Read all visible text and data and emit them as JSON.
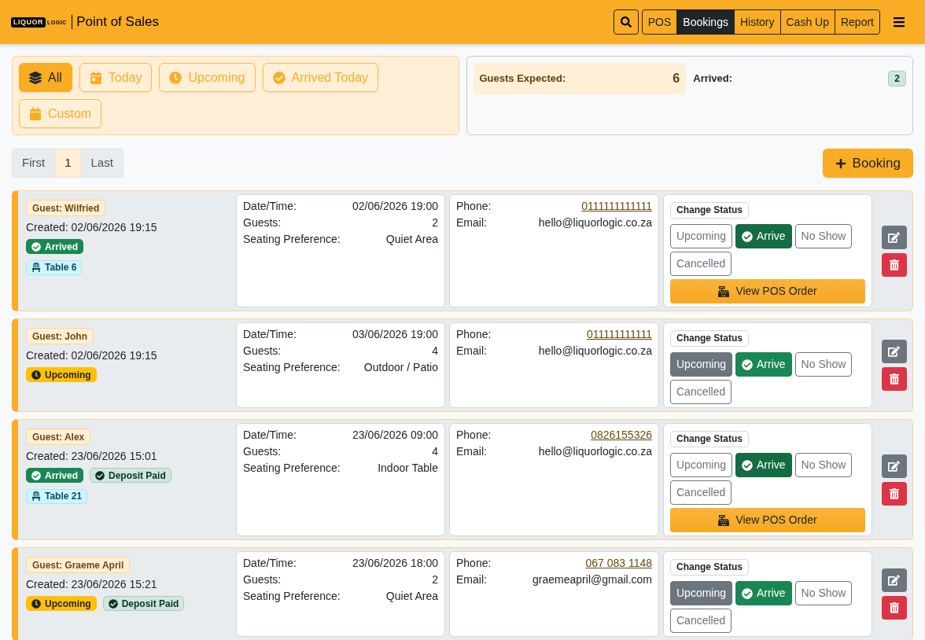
{
  "header": {
    "logo": {
      "part_1": "LIQUOR",
      "part_2": "LOGIC"
    },
    "title": "Point of Sales",
    "nav": [
      {
        "label": "POS",
        "selected": false
      },
      {
        "label": "Bookings",
        "selected": true
      },
      {
        "label": "History",
        "selected": false
      },
      {
        "label": "Cash Up",
        "selected": false
      },
      {
        "label": "Report",
        "selected": false
      }
    ]
  },
  "filters": [
    {
      "label": "All",
      "selected": true
    },
    {
      "label": "Today",
      "selected": false
    },
    {
      "label": "Upcoming",
      "selected": false
    },
    {
      "label": "Arrived Today",
      "selected": false
    },
    {
      "label": "Custom",
      "selected": false
    }
  ],
  "stats": {
    "guests_expected": {
      "label": "Guests Expected:",
      "value": "6"
    },
    "arrived": {
      "label": "Arrived:",
      "value": "2"
    }
  },
  "pagination": [
    {
      "label": "First",
      "selected": false
    },
    {
      "label": "1",
      "selected": true
    },
    {
      "label": "Last",
      "selected": false
    }
  ],
  "add_booking_button": "Booking",
  "bookings": [
    {
      "guest": "Guest: Wilfried",
      "created": "Created: 02/06/2026 19:15",
      "badges": [
        {
          "kind": "arrived",
          "label": "Arrived"
        }
      ],
      "table": "Table 6",
      "details": [
        {
          "label": "Date/Time:",
          "value": "02/06/2026 19:00"
        },
        {
          "label": "Guests:",
          "value": "2"
        },
        {
          "label": "Seating Preference:",
          "value": "Quiet Area"
        }
      ],
      "contact": [
        {
          "kind": "link",
          "label": "Phone:",
          "value": "0111111111111"
        },
        {
          "kind": "text",
          "label": "Email:",
          "value": "hello@liquorlogic.co.za"
        }
      ],
      "change_status": "Change Status",
      "status_buttons": [
        {
          "kind": "neutral",
          "label": "Upcoming",
          "selected": false
        },
        {
          "kind": "success",
          "label": "Arrive",
          "selected": true
        },
        {
          "kind": "neutral",
          "label": "No Show",
          "selected": false
        },
        {
          "kind": "neutral",
          "label": "Cancelled",
          "selected": false
        }
      ],
      "pos_order_button": "View POS Order"
    },
    {
      "guest": "Guest: John",
      "created": "Created: 02/06/2026 19:15",
      "badges": [
        {
          "kind": "upcoming",
          "label": "Upcoming"
        }
      ],
      "details": [
        {
          "label": "Date/Time:",
          "value": "03/06/2026 19:00"
        },
        {
          "label": "Guests:",
          "value": "4"
        },
        {
          "label": "Seating Preference:",
          "value": "Outdoor / Patio"
        }
      ],
      "contact": [
        {
          "kind": "link",
          "label": "Phone:",
          "value": "011111111111"
        },
        {
          "kind": "text",
          "label": "Email:",
          "value": "hello@liquorlogic.co.za"
        }
      ],
      "change_status": "Change Status",
      "status_buttons": [
        {
          "kind": "neutral",
          "label": "Upcoming",
          "selected": true
        },
        {
          "kind": "success",
          "label": "Arrive",
          "selected": false
        },
        {
          "kind": "neutral",
          "label": "No Show",
          "selected": false
        },
        {
          "kind": "neutral",
          "label": "Cancelled",
          "selected": false
        }
      ]
    },
    {
      "guest": "Guest: Alex",
      "created": "Created: 23/06/2026 15:01",
      "badges": [
        {
          "kind": "arrived",
          "label": "Arrived"
        },
        {
          "kind": "deposit",
          "label": "Deposit Paid"
        }
      ],
      "table": "Table 21",
      "details": [
        {
          "label": "Date/Time:",
          "value": "23/06/2026 09:00"
        },
        {
          "label": "Guests:",
          "value": "4"
        },
        {
          "label": "Seating Preference:",
          "value": "Indoor Table"
        }
      ],
      "contact": [
        {
          "kind": "link",
          "label": "Phone:",
          "value": "0826155326"
        },
        {
          "kind": "text",
          "label": "Email:",
          "value": "hello@liquorlogic.co.za"
        }
      ],
      "change_status": "Change Status",
      "status_buttons": [
        {
          "kind": "neutral",
          "label": "Upcoming",
          "selected": false
        },
        {
          "kind": "success",
          "label": "Arrive",
          "selected": true
        },
        {
          "kind": "neutral",
          "label": "No Show",
          "selected": false
        },
        {
          "kind": "neutral",
          "label": "Cancelled",
          "selected": false
        }
      ],
      "pos_order_button": "View POS Order"
    },
    {
      "guest": "Guest: Graeme April",
      "created": "Created: 23/06/2026 15:21",
      "badges": [
        {
          "kind": "upcoming",
          "label": "Upcoming"
        },
        {
          "kind": "deposit",
          "label": "Deposit Paid"
        }
      ],
      "details": [
        {
          "label": "Date/Time:",
          "value": "23/06/2026 18:00"
        },
        {
          "label": "Guests:",
          "value": "2"
        },
        {
          "label": "Seating Preference:",
          "value": "Quiet Area"
        }
      ],
      "contact": [
        {
          "kind": "link",
          "label": "Phone:",
          "value": "067 083 1148"
        },
        {
          "kind": "text",
          "label": "Email:",
          "value": "graemeapril@gmail.com"
        }
      ],
      "change_status": "Change Status",
      "status_buttons": [
        {
          "kind": "neutral",
          "label": "Upcoming",
          "selected": true
        },
        {
          "kind": "success",
          "label": "Arrive",
          "selected": false
        },
        {
          "kind": "neutral",
          "label": "No Show",
          "selected": false
        },
        {
          "kind": "neutral",
          "label": "Cancelled",
          "selected": false
        }
      ]
    }
  ]
}
